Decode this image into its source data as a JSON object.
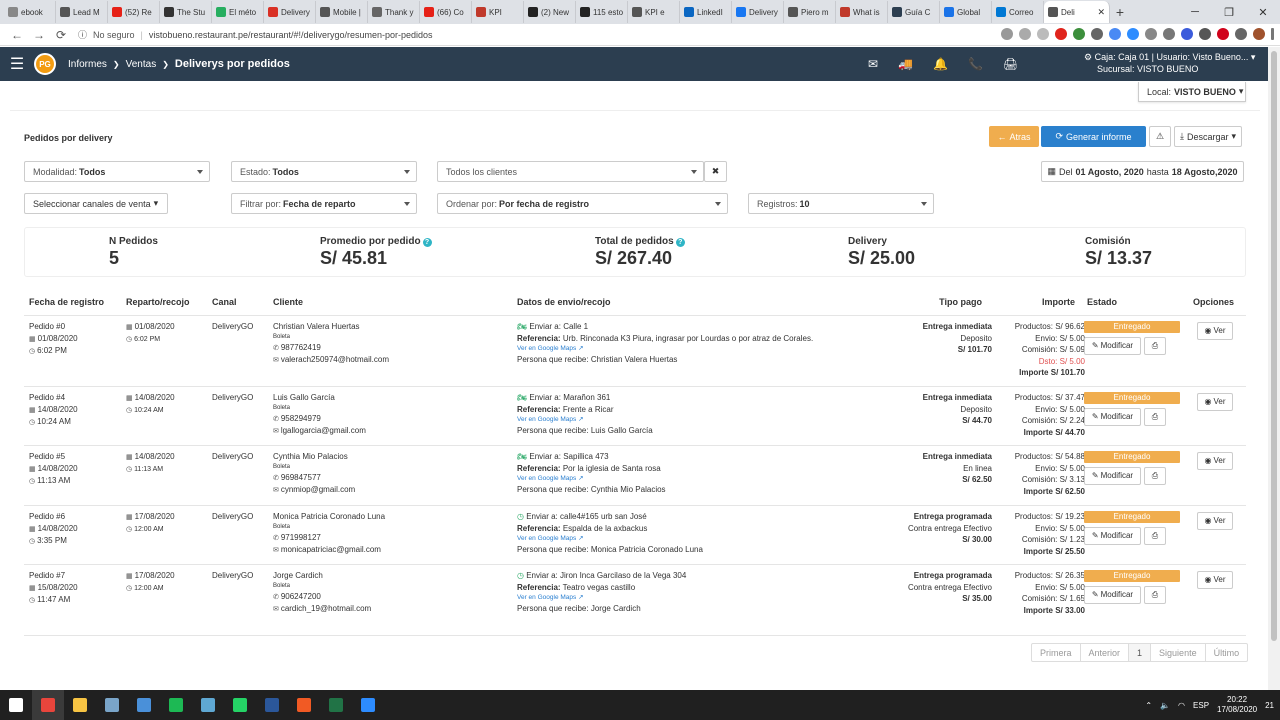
{
  "browser": {
    "tabs": [
      {
        "label": "ebook",
        "color": "#888"
      },
      {
        "label": "Lead M",
        "color": "#555"
      },
      {
        "label": "(52) Re",
        "color": "#e62117"
      },
      {
        "label": "The Stu",
        "color": "#333"
      },
      {
        "label": "El méto",
        "color": "#27ae60"
      },
      {
        "label": "Delivery",
        "color": "#d93025"
      },
      {
        "label": "Mobile |",
        "color": "#555"
      },
      {
        "label": "Thank y",
        "color": "#666"
      },
      {
        "label": "(66) Co",
        "color": "#e62117"
      },
      {
        "label": "KPI",
        "color": "#c0392b"
      },
      {
        "label": "(2) New",
        "color": "#222"
      },
      {
        "label": "115 esto",
        "color": "#222"
      },
      {
        "label": "KPI e",
        "color": "#555"
      },
      {
        "label": "LinkedI",
        "color": "#0a66c2"
      },
      {
        "label": "Delivery",
        "color": "#1877f2"
      },
      {
        "label": "Piero m",
        "color": "#555"
      },
      {
        "label": "What is",
        "color": "#c0392b"
      },
      {
        "label": "Guía C",
        "color": "#2c3e50"
      },
      {
        "label": "Global",
        "color": "#1a73e8"
      },
      {
        "label": "Correo",
        "color": "#0078d4"
      },
      {
        "label": "Deli",
        "color": "#555",
        "active": true
      }
    ],
    "new_tab": "+",
    "win_min": "─",
    "win_max": "❐",
    "win_close": "✕",
    "back": "←",
    "forward": "→",
    "reload": "⟳",
    "info": "ⓘ",
    "not_secure": "No seguro",
    "url": "vistobueno.restaurant.pe/restaurant/#!/deliverygo/resumen-por-pedidos"
  },
  "app": {
    "menu_icon": "☰",
    "logo": "PG",
    "breadcrumb": {
      "a": "Informes",
      "b": "Ventas",
      "c": "Deliverys por pedidos",
      "sep": "❯"
    },
    "icons": [
      "✉",
      "🚚",
      "🔔",
      "📞",
      "🖨"
    ],
    "session_line1": "Caja: Caja 01 | Usuario: Visto Bueno...",
    "session_line2": "Sucursal: VISTO BUENO",
    "local_label": "Local:",
    "local_value": "VISTO BUENO"
  },
  "page": {
    "title": "Pedidos por delivery",
    "btn_back": "Atras",
    "btn_generate": "Generar informe",
    "btn_warn": "⚠",
    "btn_download": "Descargar",
    "filters": {
      "modalidad_label": "Modalidad:",
      "modalidad_value": "Todos",
      "estado_label": "Estado:",
      "estado_value": "Todos",
      "clientes": "Todos los clientes",
      "clear": "✖",
      "date_prefix": "Del",
      "date_from": "01 Agosto, 2020",
      "date_mid": "hasta",
      "date_to": "18 Agosto,2020",
      "canales": "Seleccionar canales de venta",
      "filtrar_label": "Filtrar por:",
      "filtrar_value": "Fecha de reparto",
      "ordenar_label": "Ordenar por:",
      "ordenar_value": "Por fecha de registro",
      "registros_label": "Registros:",
      "registros_value": "10"
    },
    "stats": {
      "pedidos_label": "N Pedidos",
      "pedidos_value": "5",
      "promedio_label": "Promedio por pedido",
      "promedio_value": "S/ 45.81",
      "total_label": "Total de pedidos",
      "total_value": "S/ 267.40",
      "delivery_label": "Delivery",
      "delivery_value": "S/ 25.00",
      "comision_label": "Comisión",
      "comision_value": "S/ 13.37",
      "help": "?"
    },
    "headers": [
      "Fecha de registro",
      "Reparto/recojo",
      "Canal",
      "Cliente",
      "Datos de envio/recojo",
      "Tipo pago",
      "Importe",
      "Estado",
      "Opciones"
    ],
    "labels": {
      "enviar": "Enviar a:",
      "referencia": "Referencia:",
      "maps": "Ver en Google Maps",
      "persona": "Persona que recibe:",
      "productos": "Productos:",
      "envio": "Envio:",
      "comision": "Comisión:",
      "importe": "Importe",
      "modificar": "Modificar",
      "ver": "Ver",
      "dsto": "Dsto:"
    },
    "rows": [
      {
        "pedido": "Pedido #0",
        "fecha": "01/08/2020",
        "hora": "6:02 PM",
        "reparto": "01/08/2020",
        "reparto_hora": "6:02 PM",
        "canal": "DeliveryGO",
        "cliente": "Christian Valera Huertas",
        "comprobante": "Boleta",
        "tel": "987762419",
        "email": "valerach250974@hotmail.com",
        "envio": "Calle 1",
        "referencia": "Urb. Rinconada K3 Piura, ingrasar por Lourdas o por atraz de Corales.",
        "persona": "Christian Valera Huertas",
        "tipo": "Entrega inmediata",
        "metodo": "Deposito",
        "total": "S/ 101.70",
        "productos": "S/ 96.62",
        "envio_amt": "S/ 5.00",
        "comision": "S/ 5.09",
        "dsto": "S/ 5.00",
        "importe": "S/ 101.70",
        "estado": "Entregado",
        "moto": true
      },
      {
        "pedido": "Pedido #4",
        "fecha": "14/08/2020",
        "hora": "10:24 AM",
        "reparto": "14/08/2020",
        "reparto_hora": "10:24 AM",
        "canal": "DeliveryGO",
        "cliente": "Luis Gallo García",
        "comprobante": "Boleta",
        "tel": "958294979",
        "email": "lgallogarcia@gmail.com",
        "envio": "Marañon 361",
        "referencia": "Frente a Ricar",
        "persona": "Luis Gallo García",
        "tipo": "Entrega inmediata",
        "metodo": "Deposito",
        "total": "S/ 44.70",
        "productos": "S/ 37.47",
        "envio_amt": "S/ 5.00",
        "comision": "S/ 2.24",
        "importe": "S/ 44.70",
        "estado": "Entregado",
        "moto": true
      },
      {
        "pedido": "Pedido #5",
        "fecha": "14/08/2020",
        "hora": "11:13 AM",
        "reparto": "14/08/2020",
        "reparto_hora": "11:13 AM",
        "canal": "DeliveryGO",
        "cliente": "Cynthia Mio Palacios",
        "comprobante": "Boleta",
        "tel": "969847577",
        "email": "cynmiop@gmail.com",
        "envio": "Sapillica 473",
        "referencia": "Por la iglesia de Santa rosa",
        "persona": "Cynthia Mio Palacios",
        "tipo": "Entrega inmediata",
        "metodo": "En linea",
        "total": "S/ 62.50",
        "productos": "S/ 54.88",
        "envio_amt": "S/ 5.00",
        "comision": "S/ 3.13",
        "importe": "S/ 62.50",
        "estado": "Entregado",
        "moto": true
      },
      {
        "pedido": "Pedido #6",
        "fecha": "14/08/2020",
        "hora": "3:35 PM",
        "reparto": "17/08/2020",
        "reparto_hora": "12:00 AM",
        "canal": "DeliveryGO",
        "cliente": "Monica Patricia Coronado Luna",
        "comprobante": "Boleta",
        "tel": "971998127",
        "email": "monicapatriciac@gmail.com",
        "envio": "calle4#165 urb san José",
        "referencia": "Espalda de la axbackus",
        "persona": "Monica Patricia Coronado Luna",
        "tipo": "Entrega programada",
        "metodo": "Contra entrega Efectivo",
        "total": "S/ 30.00",
        "productos": "S/ 19.23",
        "envio_amt": "S/ 5.00",
        "comision": "S/ 1.23",
        "importe": "S/ 25.50",
        "estado": "Entregado",
        "moto": false
      },
      {
        "pedido": "Pedido #7",
        "fecha": "15/08/2020",
        "hora": "11:47 AM",
        "reparto": "17/08/2020",
        "reparto_hora": "12:00 AM",
        "canal": "DeliveryGO",
        "cliente": "Jorge Cardich",
        "comprobante": "Boleta",
        "tel": "906247200",
        "email": "cardich_19@hotmail.com",
        "envio": "Jiron Inca Garcilaso de la Vega 304",
        "referencia": "Teatro vegas castillo",
        "persona": "Jorge Cardich",
        "tipo": "Entrega programada",
        "metodo": "Contra entrega Efectivo",
        "total": "S/ 35.00",
        "productos": "S/ 26.35",
        "envio_amt": "S/ 5.00",
        "comision": "S/ 1.65",
        "importe": "S/ 33.00",
        "estado": "Entregado",
        "moto": false
      }
    ],
    "pager": [
      "Primera",
      "Anterior",
      "1",
      "Siguiente",
      "Último"
    ]
  },
  "taskbar": {
    "apps": [
      {
        "name": "windows",
        "color": "#ffffff"
      },
      {
        "name": "chrome",
        "color": "#e8453c"
      },
      {
        "name": "explorer",
        "color": "#f6c343"
      },
      {
        "name": "app",
        "color": "#7aa5c9"
      },
      {
        "name": "calculator",
        "color": "#4a90d9"
      },
      {
        "name": "spotify",
        "color": "#1db954"
      },
      {
        "name": "app2",
        "color": "#5fa8d3"
      },
      {
        "name": "whatsapp",
        "color": "#25d366"
      },
      {
        "name": "word",
        "color": "#2b579a"
      },
      {
        "name": "acrobat",
        "color": "#f15a24"
      },
      {
        "name": "excel",
        "color": "#217346"
      },
      {
        "name": "zoom",
        "color": "#2d8cff"
      }
    ],
    "lang": "ESP",
    "time": "20:22",
    "date": "17/08/2020",
    "notif": "21"
  },
  "colors": {
    "appbar": "#2c3e50",
    "orange": "#f0ad4e",
    "blue": "#2a80cd",
    "badge": "#f0ad4e"
  }
}
